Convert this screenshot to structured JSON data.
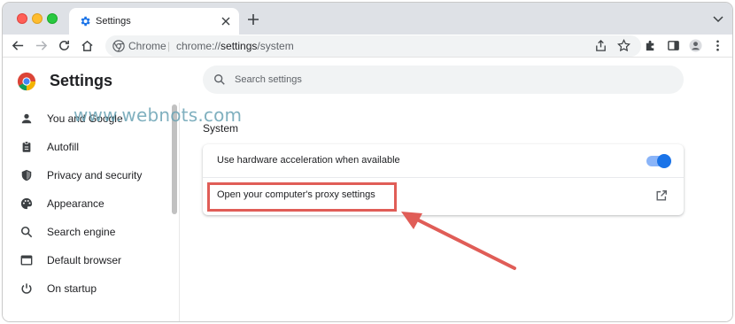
{
  "browser": {
    "tab": {
      "title": "Settings"
    },
    "omnibox": {
      "chip": "Chrome",
      "url_prefix": "chrome://",
      "url_highlight": "settings",
      "url_suffix": "/system"
    }
  },
  "settings": {
    "title": "Settings",
    "search": {
      "placeholder": "Search settings"
    },
    "sidebar": {
      "items": [
        {
          "label": "You and Google",
          "icon": "person-icon"
        },
        {
          "label": "Autofill",
          "icon": "clipboard-icon"
        },
        {
          "label": "Privacy and security",
          "icon": "shield-icon"
        },
        {
          "label": "Appearance",
          "icon": "palette-icon"
        },
        {
          "label": "Search engine",
          "icon": "search-icon"
        },
        {
          "label": "Default browser",
          "icon": "browser-window-icon"
        },
        {
          "label": "On startup",
          "icon": "power-icon"
        }
      ]
    },
    "section": {
      "title": "System",
      "rows": [
        {
          "label": "Use hardware acceleration when available",
          "control": "toggle",
          "enabled": true
        },
        {
          "label": "Open your computer's proxy settings",
          "control": "open-external-icon"
        }
      ]
    }
  },
  "watermark": "www.webnots.com",
  "colors": {
    "accent": "#1a73e8",
    "highlight": "#e05d57",
    "watermark": "#6aa3b4"
  }
}
